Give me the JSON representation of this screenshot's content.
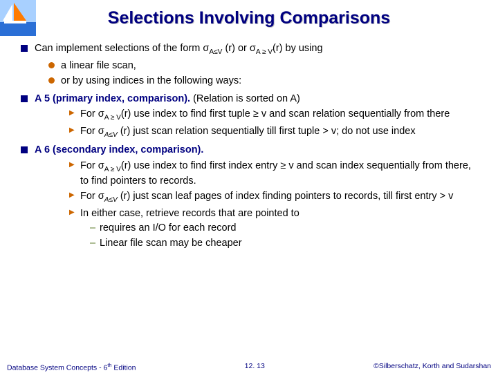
{
  "title": "Selections Involving Comparisons",
  "bullets": {
    "b1": "Can implement selections of the form σ",
    "b1_sub1": "A≤V",
    "b1_mid1": " (r) or σ",
    "b1_sub2": "A ≥ V",
    "b1_end": "(r) by using",
    "b1a": "a linear file scan,",
    "b1b": "or by using indices in the following ways:",
    "b2_head": "A 5 (primary index, comparison).",
    "b2_tail": " (Relation is sorted on A)",
    "b2a_pre": "For σ",
    "b2a_sub": "A ≥ V",
    "b2a_post": "(r)  use index to find first tuple ≥ v  and scan relation sequentially  from there",
    "b2b_pre": "For σ",
    "b2b_sub": "A≤V",
    "b2b_post": " (r) just scan relation sequentially till first tuple > v; do not use index",
    "b3_head": "A 6 (secondary index, comparison).",
    "b3a_pre": "For σ",
    "b3a_sub": "A ≥ V",
    "b3a_post": "(r)  use index to find first index entry ≥ v and scan index sequentially  from there, to find pointers to records.",
    "b3b_pre": "For σ",
    "b3b_sub": "A≤V",
    "b3b_post": " (r) just scan leaf pages of index finding pointers to records, till first entry > v",
    "b3c": "In either case, retrieve records that are pointed to",
    "b3c1": "requires an I/O for each record",
    "b3c2": "Linear file scan may be cheaper"
  },
  "footer": {
    "left_a": "Database System Concepts - 6",
    "left_b": " Edition",
    "center": "12. 13",
    "right": "©Silberschatz, Korth and Sudarshan"
  }
}
